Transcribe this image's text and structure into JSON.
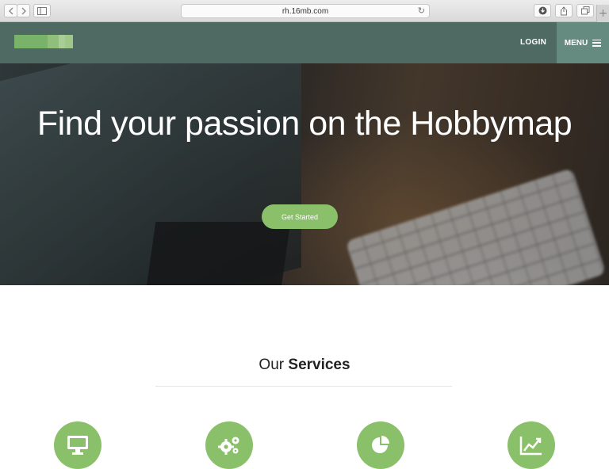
{
  "browser": {
    "url": "rh.16mb.com",
    "back_icon": "chevron-left-icon",
    "forward_icon": "chevron-right-icon",
    "reload_icon": "reload-icon",
    "new_tab_label": "+"
  },
  "navbar": {
    "login_label": "LOGIN",
    "menu_label": "MENU",
    "colors": {
      "bar": "#4f6a62",
      "menu_bg": "#658a7f"
    }
  },
  "hero": {
    "heading": "Find your passion on the Hobbymap",
    "cta_label": "Get Started",
    "accent": "#8bc06a"
  },
  "services": {
    "title_light": "Our",
    "title_bold": "Services",
    "items": [
      {
        "icon": "monitor-icon"
      },
      {
        "icon": "gears-icon"
      },
      {
        "icon": "pie-chart-icon"
      },
      {
        "icon": "line-chart-icon"
      }
    ]
  }
}
